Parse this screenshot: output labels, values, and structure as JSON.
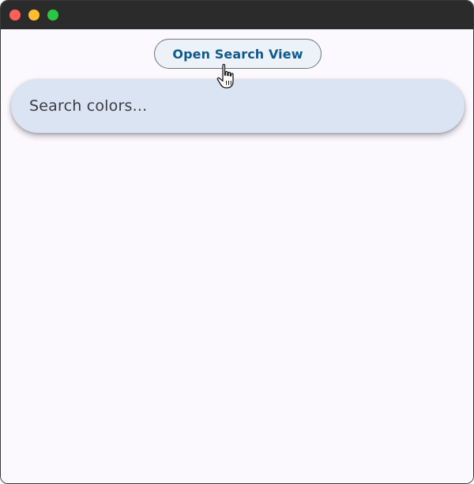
{
  "window": {
    "title": "",
    "controls": [
      "close",
      "minimize",
      "maximize"
    ]
  },
  "toolbar": {
    "open_search_label": "Open Search View"
  },
  "search": {
    "placeholder": "Search colors...",
    "value": ""
  },
  "colors": {
    "button_text": "#0f5a8c",
    "search_bar_bg": "#dbe4f2",
    "page_bg": "#fcf9fe"
  },
  "cursor": {
    "icon": "hand-pointer-icon"
  }
}
